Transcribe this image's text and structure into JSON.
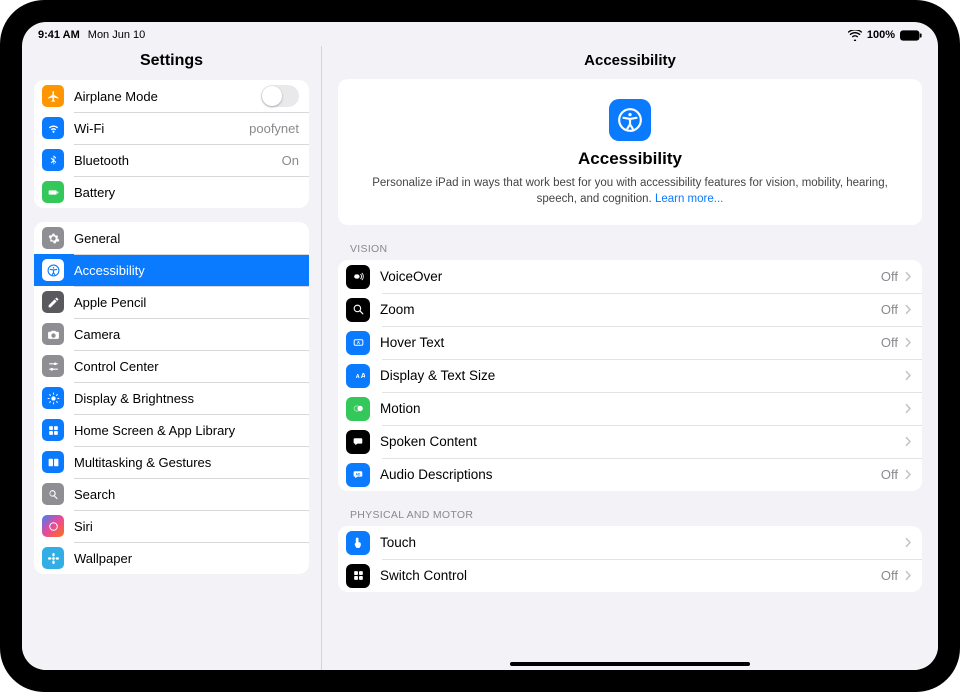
{
  "status": {
    "time": "9:41 AM",
    "date": "Mon Jun 10",
    "battery_pct": "100%"
  },
  "sidebar": {
    "title": "Settings",
    "groups": [
      {
        "rows": [
          {
            "name": "airplane-mode",
            "label": "Airplane Mode",
            "icon": "airplane",
            "bg": "bg-orange",
            "control": "switch"
          },
          {
            "name": "wifi",
            "label": "Wi-Fi",
            "icon": "wifi",
            "bg": "bg-blue",
            "value": "poofynet"
          },
          {
            "name": "bluetooth",
            "label": "Bluetooth",
            "icon": "bluetooth",
            "bg": "bg-blue",
            "value": "On"
          },
          {
            "name": "battery",
            "label": "Battery",
            "icon": "battery",
            "bg": "bg-green"
          }
        ]
      },
      {
        "rows": [
          {
            "name": "general",
            "label": "General",
            "icon": "gear",
            "bg": "bg-gray"
          },
          {
            "name": "accessibility",
            "label": "Accessibility",
            "icon": "accessibility",
            "bg": "bg-white",
            "selected": true
          },
          {
            "name": "apple-pencil",
            "label": "Apple Pencil",
            "icon": "pencil",
            "bg": "bg-dgray"
          },
          {
            "name": "camera",
            "label": "Camera",
            "icon": "camera",
            "bg": "bg-gray"
          },
          {
            "name": "control-center",
            "label": "Control Center",
            "icon": "sliders",
            "bg": "bg-gray"
          },
          {
            "name": "display-brightness",
            "label": "Display & Brightness",
            "icon": "sun",
            "bg": "bg-blue"
          },
          {
            "name": "home-screen-app-library",
            "label": "Home Screen & App Library",
            "icon": "grid",
            "bg": "bg-blue"
          },
          {
            "name": "multitasking-gestures",
            "label": "Multitasking & Gestures",
            "icon": "rectangles",
            "bg": "bg-blue"
          },
          {
            "name": "search",
            "label": "Search",
            "icon": "search",
            "bg": "bg-gray"
          },
          {
            "name": "siri",
            "label": "Siri",
            "icon": "siri",
            "bg": "bg-siri"
          },
          {
            "name": "wallpaper",
            "label": "Wallpaper",
            "icon": "flower",
            "bg": "bg-lblue"
          }
        ]
      }
    ]
  },
  "main": {
    "title": "Accessibility",
    "hero": {
      "title": "Accessibility",
      "desc": "Personalize iPad in ways that work best for you with accessibility features for vision, mobility, hearing, speech, and cognition. ",
      "learn_more": "Learn more..."
    },
    "sections": [
      {
        "header": "Vision",
        "rows": [
          {
            "name": "voiceover",
            "label": "VoiceOver",
            "icon": "voiceover",
            "bg": "bg-black",
            "value": "Off"
          },
          {
            "name": "zoom",
            "label": "Zoom",
            "icon": "zoom",
            "bg": "bg-black",
            "value": "Off"
          },
          {
            "name": "hover-text",
            "label": "Hover Text",
            "icon": "hover",
            "bg": "bg-blue",
            "value": "Off"
          },
          {
            "name": "display-text-size",
            "label": "Display & Text Size",
            "icon": "textsize",
            "bg": "bg-blue"
          },
          {
            "name": "motion",
            "label": "Motion",
            "icon": "motion",
            "bg": "bg-green"
          },
          {
            "name": "spoken-content",
            "label": "Spoken Content",
            "icon": "speech",
            "bg": "bg-black"
          },
          {
            "name": "audio-descriptions",
            "label": "Audio Descriptions",
            "icon": "audio-desc",
            "bg": "bg-blue",
            "value": "Off"
          }
        ]
      },
      {
        "header": "Physical and Motor",
        "rows": [
          {
            "name": "touch",
            "label": "Touch",
            "icon": "touch",
            "bg": "bg-blue"
          },
          {
            "name": "switch-control",
            "label": "Switch Control",
            "icon": "switch-control",
            "bg": "bg-black",
            "value": "Off"
          }
        ]
      }
    ]
  }
}
